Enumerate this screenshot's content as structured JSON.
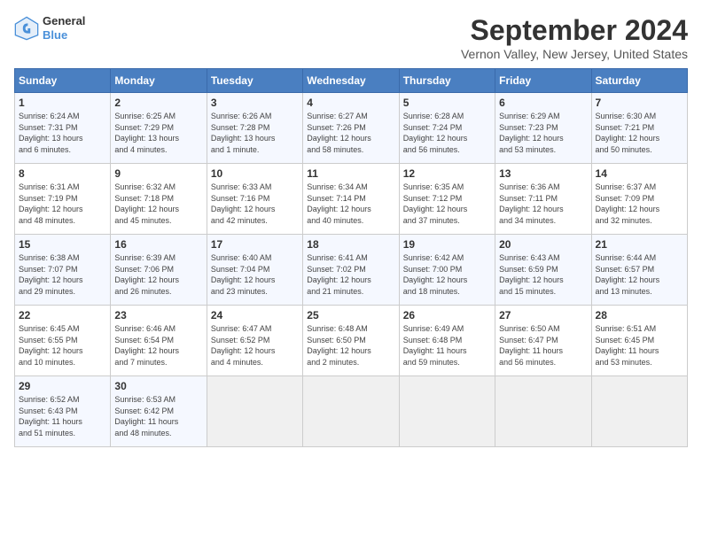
{
  "header": {
    "logo_line1": "General",
    "logo_line2": "Blue",
    "month": "September 2024",
    "location": "Vernon Valley, New Jersey, United States"
  },
  "weekdays": [
    "Sunday",
    "Monday",
    "Tuesday",
    "Wednesday",
    "Thursday",
    "Friday",
    "Saturday"
  ],
  "weeks": [
    [
      {
        "day": "1",
        "content": "Sunrise: 6:24 AM\nSunset: 7:31 PM\nDaylight: 13 hours\nand 6 minutes."
      },
      {
        "day": "2",
        "content": "Sunrise: 6:25 AM\nSunset: 7:29 PM\nDaylight: 13 hours\nand 4 minutes."
      },
      {
        "day": "3",
        "content": "Sunrise: 6:26 AM\nSunset: 7:28 PM\nDaylight: 13 hours\nand 1 minute."
      },
      {
        "day": "4",
        "content": "Sunrise: 6:27 AM\nSunset: 7:26 PM\nDaylight: 12 hours\nand 58 minutes."
      },
      {
        "day": "5",
        "content": "Sunrise: 6:28 AM\nSunset: 7:24 PM\nDaylight: 12 hours\nand 56 minutes."
      },
      {
        "day": "6",
        "content": "Sunrise: 6:29 AM\nSunset: 7:23 PM\nDaylight: 12 hours\nand 53 minutes."
      },
      {
        "day": "7",
        "content": "Sunrise: 6:30 AM\nSunset: 7:21 PM\nDaylight: 12 hours\nand 50 minutes."
      }
    ],
    [
      {
        "day": "8",
        "content": "Sunrise: 6:31 AM\nSunset: 7:19 PM\nDaylight: 12 hours\nand 48 minutes."
      },
      {
        "day": "9",
        "content": "Sunrise: 6:32 AM\nSunset: 7:18 PM\nDaylight: 12 hours\nand 45 minutes."
      },
      {
        "day": "10",
        "content": "Sunrise: 6:33 AM\nSunset: 7:16 PM\nDaylight: 12 hours\nand 42 minutes."
      },
      {
        "day": "11",
        "content": "Sunrise: 6:34 AM\nSunset: 7:14 PM\nDaylight: 12 hours\nand 40 minutes."
      },
      {
        "day": "12",
        "content": "Sunrise: 6:35 AM\nSunset: 7:12 PM\nDaylight: 12 hours\nand 37 minutes."
      },
      {
        "day": "13",
        "content": "Sunrise: 6:36 AM\nSunset: 7:11 PM\nDaylight: 12 hours\nand 34 minutes."
      },
      {
        "day": "14",
        "content": "Sunrise: 6:37 AM\nSunset: 7:09 PM\nDaylight: 12 hours\nand 32 minutes."
      }
    ],
    [
      {
        "day": "15",
        "content": "Sunrise: 6:38 AM\nSunset: 7:07 PM\nDaylight: 12 hours\nand 29 minutes."
      },
      {
        "day": "16",
        "content": "Sunrise: 6:39 AM\nSunset: 7:06 PM\nDaylight: 12 hours\nand 26 minutes."
      },
      {
        "day": "17",
        "content": "Sunrise: 6:40 AM\nSunset: 7:04 PM\nDaylight: 12 hours\nand 23 minutes."
      },
      {
        "day": "18",
        "content": "Sunrise: 6:41 AM\nSunset: 7:02 PM\nDaylight: 12 hours\nand 21 minutes."
      },
      {
        "day": "19",
        "content": "Sunrise: 6:42 AM\nSunset: 7:00 PM\nDaylight: 12 hours\nand 18 minutes."
      },
      {
        "day": "20",
        "content": "Sunrise: 6:43 AM\nSunset: 6:59 PM\nDaylight: 12 hours\nand 15 minutes."
      },
      {
        "day": "21",
        "content": "Sunrise: 6:44 AM\nSunset: 6:57 PM\nDaylight: 12 hours\nand 13 minutes."
      }
    ],
    [
      {
        "day": "22",
        "content": "Sunrise: 6:45 AM\nSunset: 6:55 PM\nDaylight: 12 hours\nand 10 minutes."
      },
      {
        "day": "23",
        "content": "Sunrise: 6:46 AM\nSunset: 6:54 PM\nDaylight: 12 hours\nand 7 minutes."
      },
      {
        "day": "24",
        "content": "Sunrise: 6:47 AM\nSunset: 6:52 PM\nDaylight: 12 hours\nand 4 minutes."
      },
      {
        "day": "25",
        "content": "Sunrise: 6:48 AM\nSunset: 6:50 PM\nDaylight: 12 hours\nand 2 minutes."
      },
      {
        "day": "26",
        "content": "Sunrise: 6:49 AM\nSunset: 6:48 PM\nDaylight: 11 hours\nand 59 minutes."
      },
      {
        "day": "27",
        "content": "Sunrise: 6:50 AM\nSunset: 6:47 PM\nDaylight: 11 hours\nand 56 minutes."
      },
      {
        "day": "28",
        "content": "Sunrise: 6:51 AM\nSunset: 6:45 PM\nDaylight: 11 hours\nand 53 minutes."
      }
    ],
    [
      {
        "day": "29",
        "content": "Sunrise: 6:52 AM\nSunset: 6:43 PM\nDaylight: 11 hours\nand 51 minutes."
      },
      {
        "day": "30",
        "content": "Sunrise: 6:53 AM\nSunset: 6:42 PM\nDaylight: 11 hours\nand 48 minutes."
      },
      {
        "day": "",
        "content": ""
      },
      {
        "day": "",
        "content": ""
      },
      {
        "day": "",
        "content": ""
      },
      {
        "day": "",
        "content": ""
      },
      {
        "day": "",
        "content": ""
      }
    ]
  ]
}
